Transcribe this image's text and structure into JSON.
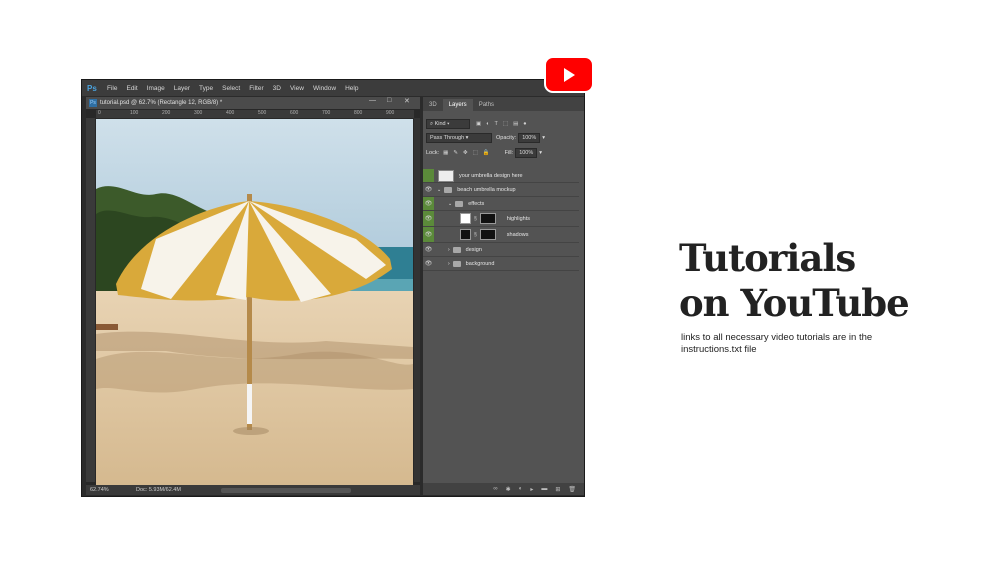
{
  "app": {
    "logo": "Ps",
    "menu": [
      "File",
      "Edit",
      "Image",
      "Layer",
      "Type",
      "Select",
      "Filter",
      "3D",
      "View",
      "Window",
      "Help"
    ]
  },
  "document": {
    "tab_title": "tutorial.psd @ 62.7% (Rectangle 12, RGB/8) *",
    "window_controls": [
      "—",
      "□",
      "✕"
    ],
    "ruler_ticks": [
      "0",
      "100",
      "200",
      "300",
      "400",
      "500",
      "600",
      "700",
      "800",
      "900"
    ],
    "status_zoom": "62.74%",
    "status_doc": "Doc: 5.93M/62.4M"
  },
  "panel": {
    "tabs": [
      "3D",
      "Layers",
      "Paths"
    ],
    "active_tab": "Layers",
    "kind_label": "Kind",
    "blend_mode": "Pass Through",
    "opacity_label": "Opacity:",
    "opacity_value": "100%",
    "lock_label": "Lock:",
    "fill_label": "Fill:",
    "fill_value": "100%",
    "layers": [
      {
        "name": "your umbrella design here",
        "type": "smart",
        "indent": 0
      },
      {
        "name": "beach umbrella mockup",
        "type": "group",
        "indent": 0
      },
      {
        "name": "effects",
        "type": "group",
        "indent": 1
      },
      {
        "name": "highlights",
        "type": "layer-white",
        "indent": 2
      },
      {
        "name": "shadows",
        "type": "layer-black",
        "indent": 2
      },
      {
        "name": "design",
        "type": "group",
        "indent": 1
      },
      {
        "name": "background",
        "type": "group",
        "indent": 1
      }
    ]
  },
  "promo": {
    "title_line1": "Tutorials",
    "title_line2": "on YouTube",
    "description": "links to all necessary video tutorials are in the instructions.txt file",
    "brand_color": "#ff0000"
  }
}
